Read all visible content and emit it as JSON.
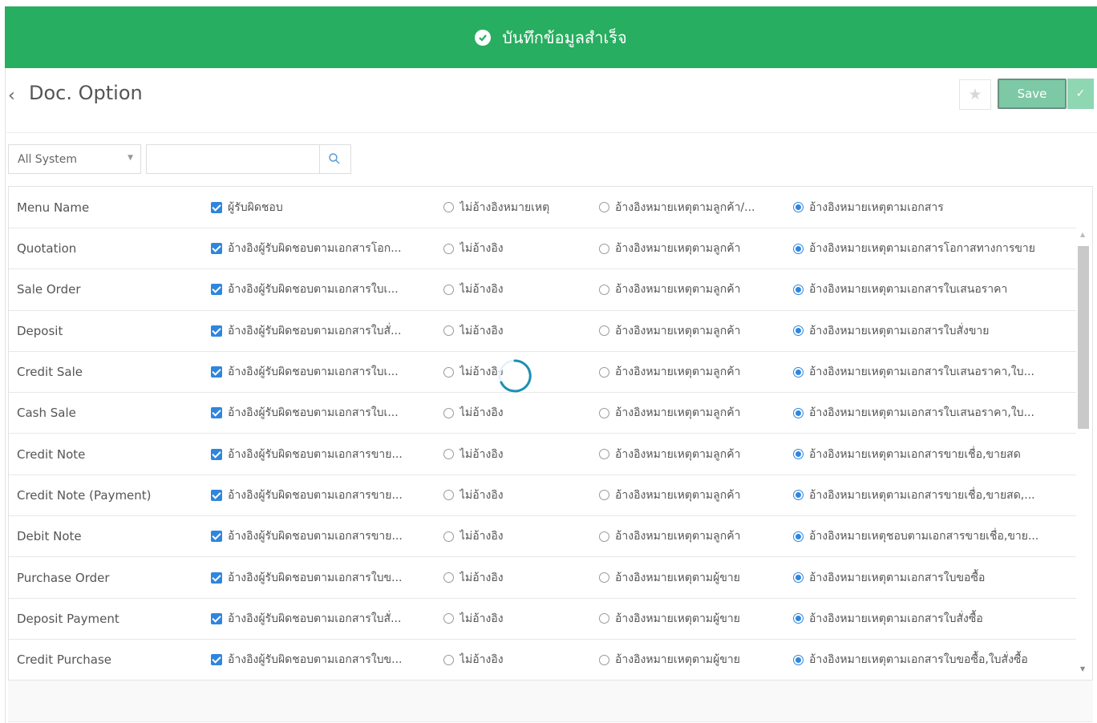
{
  "toast": {
    "message": "บันทึกข้อมูลสำเร็จ",
    "color": "#27ae60"
  },
  "header": {
    "back_icon": "‹",
    "title": "Doc. Option",
    "star_icon": "★",
    "save_label": "Save",
    "check_icon": "✓"
  },
  "filter": {
    "selected": "All System",
    "search_placeholder": ""
  },
  "table": {
    "headers": [
      "Menu Name",
      "ผู้รับผิดชอบ",
      "ไม่อ้างอิงหมายเหตุ",
      "อ้างอิงหมายเหตุตามลูกค้า/...",
      "อ้างอิงหมายเหตุตามเอกสาร"
    ],
    "header_state": {
      "checkbox": true,
      "selected_radio": 4
    },
    "rows": [
      {
        "name": "Quotation",
        "resp": "อ้างอิงผู้รับผิดชอบตามเอกสารโอก...",
        "none": "ไม่อ้างอิง",
        "cust": "อ้างอิงหมายเหตุตามลูกค้า",
        "doc": "อ้างอิงหมายเหตุตามเอกสารโอกาสทางการขาย"
      },
      {
        "name": "Sale Order",
        "resp": "อ้างอิงผู้รับผิดชอบตามเอกสารใบเ...",
        "none": "ไม่อ้างอิง",
        "cust": "อ้างอิงหมายเหตุตามลูกค้า",
        "doc": "อ้างอิงหมายเหตุตามเอกสารใบเสนอราคา"
      },
      {
        "name": "Deposit",
        "resp": "อ้างอิงผู้รับผิดชอบตามเอกสารใบสั่...",
        "none": "ไม่อ้างอิง",
        "cust": "อ้างอิงหมายเหตุตามลูกค้า",
        "doc": "อ้างอิงหมายเหตุตามเอกสารใบสั่งขาย"
      },
      {
        "name": "Credit Sale",
        "resp": "อ้างอิงผู้รับผิดชอบตามเอกสารใบเ...",
        "none": "ไม่อ้างอิง",
        "cust": "อ้างอิงหมายเหตุตามลูกค้า",
        "doc": "อ้างอิงหมายเหตุตามเอกสารใบเสนอราคา,ใบ..."
      },
      {
        "name": "Cash Sale",
        "resp": "อ้างอิงผู้รับผิดชอบตามเอกสารใบเ...",
        "none": "ไม่อ้างอิง",
        "cust": "อ้างอิงหมายเหตุตามลูกค้า",
        "doc": "อ้างอิงหมายเหตุตามเอกสารใบเสนอราคา,ใบ..."
      },
      {
        "name": "Credit Note",
        "resp": "อ้างอิงผู้รับผิดชอบตามเอกสารขาย...",
        "none": "ไม่อ้างอิง",
        "cust": "อ้างอิงหมายเหตุตามลูกค้า",
        "doc": "อ้างอิงหมายเหตุตามเอกสารขายเชื่อ,ขายสด"
      },
      {
        "name": "Credit Note (Payment)",
        "resp": "อ้างอิงผู้รับผิดชอบตามเอกสารขาย...",
        "none": "ไม่อ้างอิง",
        "cust": "อ้างอิงหมายเหตุตามลูกค้า",
        "doc": "อ้างอิงหมายเหตุตามเอกสารขายเชื่อ,ขายสด,..."
      },
      {
        "name": "Debit Note",
        "resp": "อ้างอิงผู้รับผิดชอบตามเอกสารขาย...",
        "none": "ไม่อ้างอิง",
        "cust": "อ้างอิงหมายเหตุตามลูกค้า",
        "doc": "อ้างอิงหมายเหตุชอบตามเอกสารขายเชื่อ,ขาย..."
      },
      {
        "name": "Purchase Order",
        "resp": "อ้างอิงผู้รับผิดชอบตามเอกสารใบข...",
        "none": "ไม่อ้างอิง",
        "cust": "อ้างอิงหมายเหตุตามผู้ขาย",
        "doc": "อ้างอิงหมายเหตุตามเอกสารใบขอซื้อ"
      },
      {
        "name": "Deposit Payment",
        "resp": "อ้างอิงผู้รับผิดชอบตามเอกสารใบสั่...",
        "none": "ไม่อ้างอิง",
        "cust": "อ้างอิงหมายเหตุตามผู้ขาย",
        "doc": "อ้างอิงหมายเหตุตามเอกสารใบสั่งซื้อ"
      },
      {
        "name": "Credit Purchase",
        "resp": "อ้างอิงผู้รับผิดชอบตามเอกสารใบข...",
        "none": "ไม่อ้างอิง",
        "cust": "อ้างอิงหมายเหตุตามผู้ขาย",
        "doc": "อ้างอิงหมายเหตุตามเอกสารใบขอซื้อ,ใบสั่งซื้อ"
      }
    ]
  },
  "colors": {
    "accent": "#2e86de",
    "save": "#7dc9a5"
  }
}
